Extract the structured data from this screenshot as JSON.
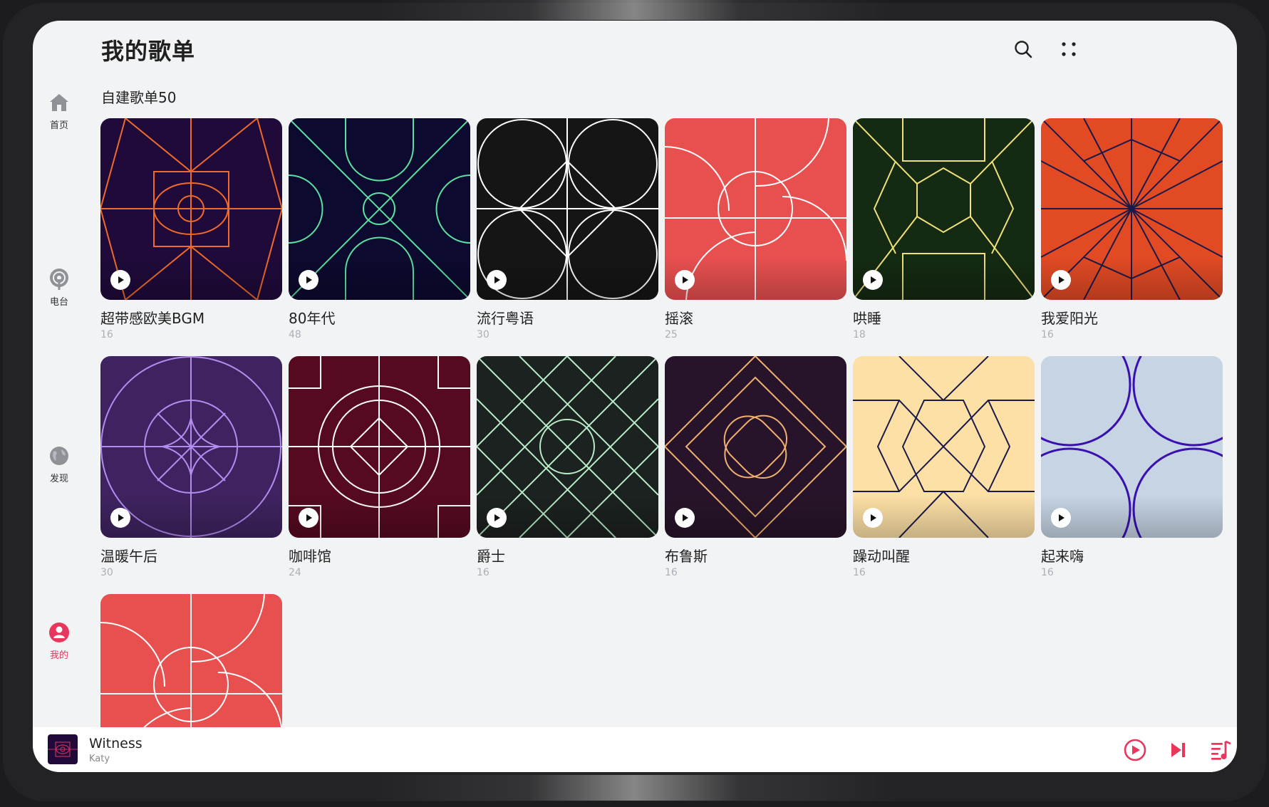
{
  "header": {
    "title": "我的歌单"
  },
  "icons": {
    "search": "search-icon",
    "more": "more-dots-icon"
  },
  "nav": {
    "items": [
      {
        "label": "首页",
        "icon": "home-icon"
      },
      {
        "label": "电台",
        "icon": "radio-icon"
      },
      {
        "label": "发现",
        "icon": "globe-icon"
      },
      {
        "label": "我的",
        "icon": "user-icon",
        "active": true
      }
    ],
    "active_color": "#e8365d"
  },
  "section": {
    "title": "自建歌单50"
  },
  "playlists": [
    {
      "title": "超带感欧美BGM",
      "count": "16",
      "bg": "#1f0a3a",
      "fg": "#f06a2a"
    },
    {
      "title": "80年代",
      "count": "48",
      "bg": "#0c0a2e",
      "fg": "#5ce0a0"
    },
    {
      "title": "流行粤语",
      "count": "30",
      "bg": "#151515",
      "fg": "#ffffff"
    },
    {
      "title": "摇滚",
      "count": "25",
      "bg": "#e85050",
      "fg": "#ffffff"
    },
    {
      "title": "哄睡",
      "count": "18",
      "bg": "#142a12",
      "fg": "#f0e07a"
    },
    {
      "title": "我爱阳光",
      "count": "16",
      "bg": "#e24a24",
      "fg": "#1a1a4a"
    },
    {
      "title": "温暖午后",
      "count": "30",
      "bg": "#3f2360",
      "fg": "#b38cf0"
    },
    {
      "title": "咖啡馆",
      "count": "24",
      "bg": "#560a20",
      "fg": "#ffffff"
    },
    {
      "title": "爵士",
      "count": "16",
      "bg": "#1c2220",
      "fg": "#b8ecc8"
    },
    {
      "title": "布鲁斯",
      "count": "16",
      "bg": "#28142a",
      "fg": "#f0b070"
    },
    {
      "title": "躁动叫醒",
      "count": "16",
      "bg": "#fde0a6",
      "fg": "#1a1a4a"
    },
    {
      "title": "起来嗨",
      "count": "16",
      "bg": "#c6d4e4",
      "fg": "#3a10b0"
    },
    {
      "title": "",
      "count": "",
      "bg": "#e85050",
      "fg": "#ffffff"
    }
  ],
  "player": {
    "title": "Witness",
    "artist": "Katy",
    "accent": "#e8365d",
    "play_icon": "play-circle-icon",
    "next_icon": "skip-next-icon",
    "queue_icon": "playlist-icon"
  }
}
